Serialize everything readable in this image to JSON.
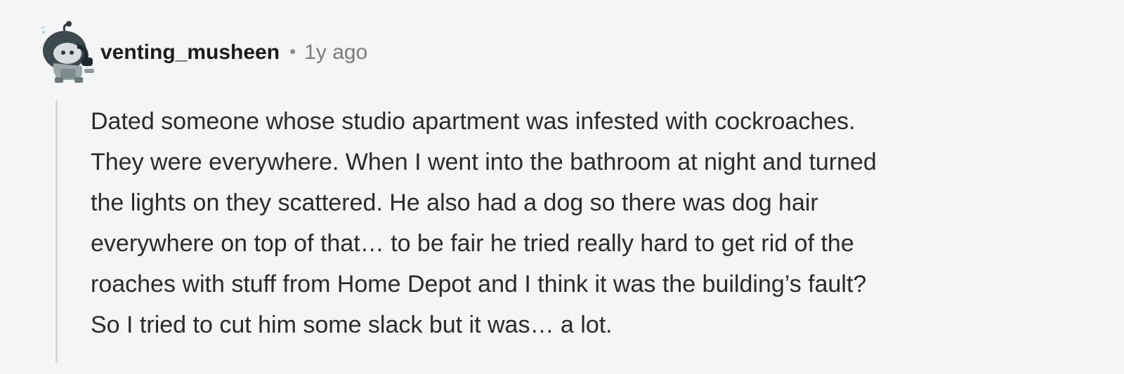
{
  "comment": {
    "avatar_icon": "snoo-avatar-icon",
    "username": "venting_musheen",
    "separator": "•",
    "timestamp": "1y ago",
    "body_lines": [
      "Dated someone whose studio apartment was infested with cockroaches.",
      "They were everywhere. When I went into the bathroom at night and turned",
      "the lights on they scattered. He also had a dog so there was dog hair",
      "everywhere on top of that… to be fair he tried really hard to get rid of the",
      "roaches with stuff from Home Depot and I think it was the building’s fault?",
      "So I tried to cut him some slack but it was… a lot."
    ]
  }
}
